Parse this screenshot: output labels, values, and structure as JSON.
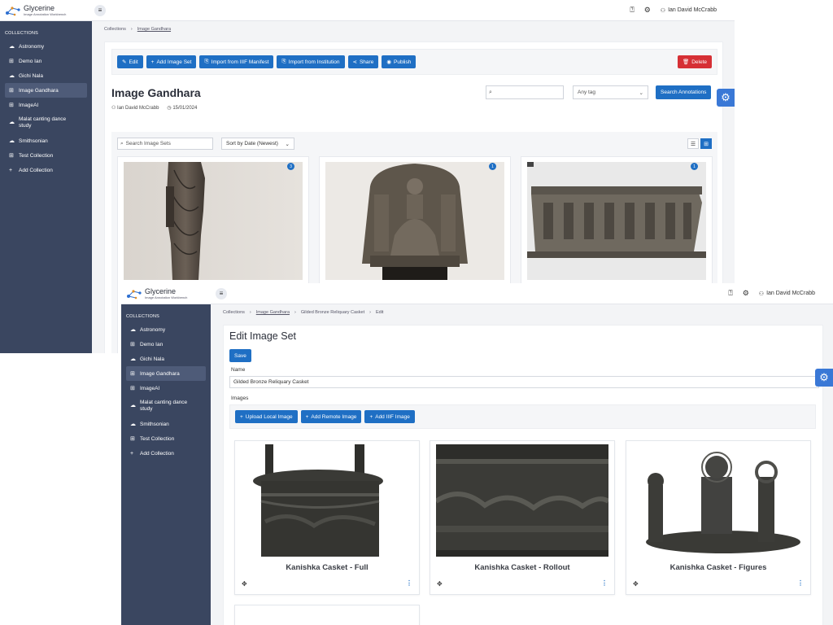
{
  "app": {
    "title": "Glycerine",
    "subtitle": "Image Annotation Workbench",
    "user": "Ian David McCrabb"
  },
  "colors": {
    "sidebar": "#3a4660",
    "primary": "#1f6fc4",
    "danger": "#d63035",
    "gear_fab": "#3a78d6"
  },
  "icons": {
    "help": "help-circle-icon",
    "settings": "gear-icon",
    "user": "user-icon",
    "menu": "hamburger-icon"
  },
  "sidebar": {
    "heading": "COLLECTIONS",
    "items": [
      {
        "label": "Astronomy",
        "icon": "cloud-icon"
      },
      {
        "label": "Demo Ian",
        "icon": "grid-icon"
      },
      {
        "label": "Gichi Nala",
        "icon": "cloud-icon"
      },
      {
        "label": "Image Gandhara",
        "icon": "grid-icon",
        "active": true
      },
      {
        "label": "ImageAI",
        "icon": "grid-icon"
      },
      {
        "label": "Malat canting dance study",
        "icon": "cloud-icon"
      },
      {
        "label": "Smithsonian",
        "icon": "cloud-icon"
      },
      {
        "label": "Test Collection",
        "icon": "grid-icon"
      },
      {
        "label": "Add Collection",
        "icon": "plus-icon"
      }
    ]
  },
  "collection_view": {
    "breadcrumb": [
      "Collections",
      "Image Gandhara"
    ],
    "toolbar": {
      "edit": "Edit",
      "add_image_set": "Add Image Set",
      "import_iiif": "Import from IIIF Manifest",
      "import_institution": "Import from Institution",
      "share": "Share",
      "publish": "Publish",
      "delete": "Delete"
    },
    "title": "Image Gandhara",
    "owner": "Ian David McCrabb",
    "date": "15/01/2024",
    "tag_select": "Any tag",
    "search_annotations": "Search Annotations",
    "search_sets_placeholder": "Search Image Sets",
    "sort": "Sort by Date (Newest)",
    "cards": [
      {
        "badge": "3"
      },
      {
        "badge": "1"
      },
      {
        "badge": "1"
      }
    ]
  },
  "edit_view": {
    "breadcrumb": [
      "Collections",
      "Image Gandhara",
      "Gilded Bronze Reliquary Casket",
      "Edit"
    ],
    "title": "Edit Image Set",
    "save": "Save",
    "name_label": "Name",
    "name_value": "Gilded Bronze Reliquary Casket",
    "images_label": "Images",
    "upload_local": "Upload Local Image",
    "add_remote": "Add Remote Image",
    "add_iiif": "Add IIIF Image",
    "cards": [
      {
        "caption": "Kanishka Casket - Full"
      },
      {
        "caption": "Kanishka Casket - Rollout"
      },
      {
        "caption": "Kanishka Casket - Figures"
      }
    ]
  }
}
